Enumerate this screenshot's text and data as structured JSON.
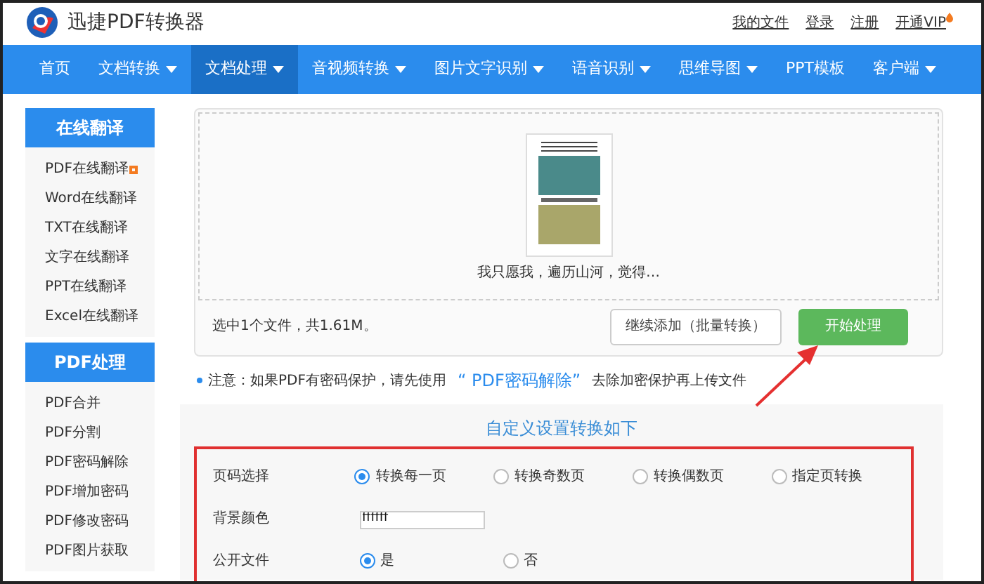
{
  "header": {
    "logo_text": "迅捷PDF转换器",
    "links": [
      {
        "label": "我的文件"
      },
      {
        "label": "登录"
      },
      {
        "label": "注册"
      },
      {
        "label": "开通VIP",
        "hot": true
      }
    ]
  },
  "nav": [
    {
      "label": "首页",
      "caret": false,
      "selected": false
    },
    {
      "label": "文档转换",
      "caret": true,
      "selected": false
    },
    {
      "label": "文档处理",
      "caret": true,
      "selected": true
    },
    {
      "label": "音视频转换",
      "caret": true,
      "selected": false
    },
    {
      "label": "图片文字识别",
      "caret": true,
      "selected": false
    },
    {
      "label": "语音识别",
      "caret": true,
      "selected": false
    },
    {
      "label": "思维导图",
      "caret": true,
      "selected": false
    },
    {
      "label": "PPT模板",
      "caret": false,
      "selected": false
    },
    {
      "label": "客户端",
      "caret": true,
      "selected": false
    }
  ],
  "sidebar": [
    {
      "title": "在线翻译",
      "items": [
        {
          "label": "PDF在线翻译",
          "badge": true
        },
        {
          "label": "Word在线翻译",
          "badge": false
        },
        {
          "label": "TXT在线翻译",
          "badge": false
        },
        {
          "label": "文字在线翻译",
          "badge": false
        },
        {
          "label": "PPT在线翻译",
          "badge": false
        },
        {
          "label": "Excel在线翻译",
          "badge": false
        }
      ]
    },
    {
      "title": "PDF处理",
      "items": [
        {
          "label": "PDF合并",
          "badge": false
        },
        {
          "label": "PDF分割",
          "badge": false
        },
        {
          "label": "PDF密码解除",
          "badge": false
        },
        {
          "label": "PDF增加密码",
          "badge": false
        },
        {
          "label": "PDF修改密码",
          "badge": false
        },
        {
          "label": "PDF图片获取",
          "badge": false
        }
      ]
    }
  ],
  "upload": {
    "file_name": "我只愿我，遍历山河，觉得…",
    "summary": "选中1个文件，共1.61M。",
    "add_button": "继续添加（批量转换）",
    "start_button": "开始处理"
  },
  "notice": {
    "before": "注意：如果PDF有密码保护，请先使用",
    "link": "“ PDF密码解除”",
    "after": "去除加密保护再上传文件"
  },
  "settings": {
    "title": "自定义设置转换如下",
    "rows": [
      {
        "kind": "radio",
        "label": "页码选择",
        "options": [
          {
            "label": "转换每一页",
            "selected": true
          },
          {
            "label": "转换奇数页",
            "selected": false
          },
          {
            "label": "转换偶数页",
            "selected": false
          },
          {
            "label": "指定页转换",
            "selected": false
          }
        ]
      },
      {
        "kind": "text",
        "label": "背景颜色",
        "value": "ffffff"
      },
      {
        "kind": "radio",
        "label": "公开文件",
        "options": [
          {
            "label": "是",
            "selected": true
          },
          {
            "label": "否",
            "selected": false
          }
        ]
      }
    ]
  }
}
